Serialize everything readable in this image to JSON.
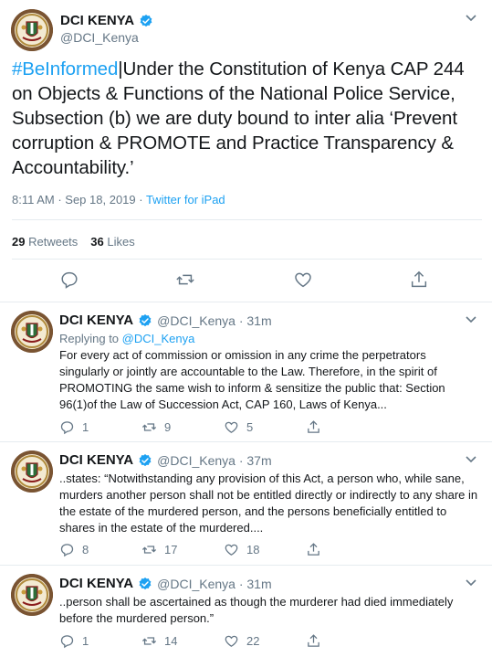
{
  "main_tweet": {
    "author_name": "DCI KENYA",
    "author_handle": "@DCI_Kenya",
    "hashtag": "#BeInformed",
    "text": "|Under the Constitution of Kenya CAP 244 on Objects & Functions of the National Police Service, Subsection (b) we are duty bound to inter alia ‘Prevent corruption & PROMOTE and Practice Transparency & Accountability.’",
    "time": "8:11 AM · Sep 18, 2019 · ",
    "source": "Twitter for iPad",
    "retweets_count": "29",
    "retweets_label": "Retweets",
    "likes_count": "36",
    "likes_label": "Likes"
  },
  "replies": [
    {
      "author_name": "DCI KENYA",
      "author_handle": "@DCI_Kenya · 31m",
      "replying_prefix": "Replying to ",
      "replying_to": "@DCI_Kenya",
      "text": "For every act of commission or omission in any crime the perpetrators singularly or jointly are accountable to the Law. Therefore, in the spirit of PROMOTING the same wish to inform & sensitize the public that: Section 96(1)of the Law of Succession Act, CAP 160, Laws of Kenya...",
      "reply_count": "1",
      "retweet_count": "9",
      "like_count": "5"
    },
    {
      "author_name": "DCI KENYA",
      "author_handle": "@DCI_Kenya · 37m",
      "text": "..states: “Notwithstanding any provision of this Act, a person who, while sane, murders another person shall not be entitled directly or indirectly to any share in the estate of the murdered person, and the persons beneficially entitled to shares in the estate of the murdered....",
      "reply_count": "8",
      "retweet_count": "17",
      "like_count": "18"
    },
    {
      "author_name": "DCI KENYA",
      "author_handle": "@DCI_Kenya · 31m",
      "text": "..person shall be ascertained as though the murderer had died immediately before the murdered person.”",
      "reply_count": "1",
      "retweet_count": "14",
      "like_count": "22"
    }
  ],
  "colors": {
    "link": "#1da1f2",
    "secondary_text": "#657786",
    "divider": "#e6ecf0",
    "avatar": "#6b4a2b"
  },
  "icons": [
    "verified-badge-icon",
    "chevron-down-icon",
    "reply-icon",
    "retweet-icon",
    "like-icon",
    "share-icon",
    "crest-logo"
  ]
}
